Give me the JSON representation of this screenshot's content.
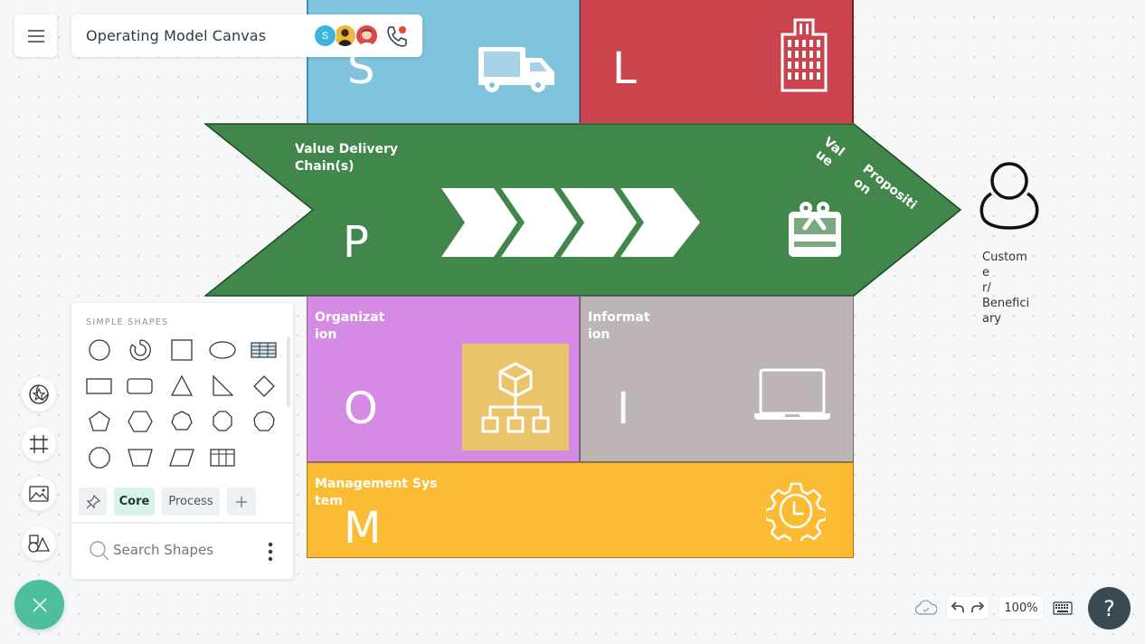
{
  "header": {
    "menu_icon": "hamburger-menu-icon",
    "document_title": "Operating Model Canvas",
    "collaborators": [
      {
        "initial": "S",
        "color": "#3db4e0"
      },
      {
        "initial": "",
        "color": "#f2b63c"
      },
      {
        "initial": "",
        "color": "#e04848"
      }
    ],
    "call_icon": "phone-call-icon",
    "call_indicator_color": "#e84545"
  },
  "canvas": {
    "blocks": {
      "suppliers": {
        "letter": "S",
        "icon": "truck-icon",
        "color": "#7fc3dd"
      },
      "locations": {
        "letter": "L",
        "icon": "building-icon",
        "color": "#cb444d"
      },
      "value_chain": {
        "label": "Value Delivery Chain(s)",
        "label_line1": "Value Delivery",
        "label_line2": "Chain(s)",
        "letter": "P",
        "icon": "chevron-process-icon",
        "color": "#41864a"
      },
      "value_proposition": {
        "label": "Value Proposition",
        "fragments": [
          "Val",
          "ue",
          "Propositi",
          "on"
        ],
        "icon": "gift-icon"
      },
      "organization": {
        "label": "Organization",
        "label_line1": "Organizat",
        "label_line2": "ion",
        "letter": "O",
        "icon": "org-chart-icon",
        "color": "#d58be3"
      },
      "information": {
        "label": "Information",
        "label_line1": "Informat",
        "label_line2": "ion",
        "letter": "I",
        "icon": "laptop-icon",
        "color": "#bcb4b5"
      },
      "management_system": {
        "label": "Management System",
        "label_line1": "Management Sys",
        "label_line2": "tem",
        "letter": "M",
        "icon": "gear-clock-icon",
        "color": "#fbbc33"
      }
    },
    "customer": {
      "icon": "user-icon",
      "label": "Customer/Beneficiary",
      "label_lines": [
        "Custome",
        "r/",
        "Benefici",
        "ary"
      ]
    }
  },
  "left_rail": {
    "buttons": [
      {
        "name": "templates",
        "icon": "star-sticker-icon"
      },
      {
        "name": "frame",
        "icon": "frame-grid-icon"
      },
      {
        "name": "image",
        "icon": "image-icon"
      },
      {
        "name": "shapes",
        "icon": "shapes-icon"
      }
    ],
    "close_icon": "close-icon",
    "close_color": "#4dbf9e"
  },
  "shapes_panel": {
    "heading": "SIMPLE SHAPES",
    "shapes": [
      [
        "circle",
        "donut",
        "square",
        "ellipse",
        "table"
      ],
      [
        "rectangle",
        "rounded-rectangle",
        "triangle",
        "right-triangle",
        "diamond"
      ],
      [
        "pentagon",
        "hexagon",
        "heptagon",
        "octagon",
        "nonagon"
      ],
      [
        "decagon",
        "trapezoid",
        "parallelogram",
        "grid-table"
      ]
    ],
    "tabs": [
      {
        "label": "",
        "icon": "pin-icon"
      },
      {
        "label": "Core",
        "active": true
      },
      {
        "label": "Process",
        "active": false
      },
      {
        "label": "",
        "icon": "plus-icon"
      }
    ],
    "search": {
      "placeholder": "Search Shapes",
      "value": ""
    },
    "more_icon": "more-vertical-icon"
  },
  "bottom_bar": {
    "save_status_icon": "cloud-saved-icon",
    "undo_icon": "undo-icon",
    "redo_icon": "redo-icon",
    "zoom_level": "100%",
    "keyboard_icon": "keyboard-icon",
    "help_label": "?"
  }
}
